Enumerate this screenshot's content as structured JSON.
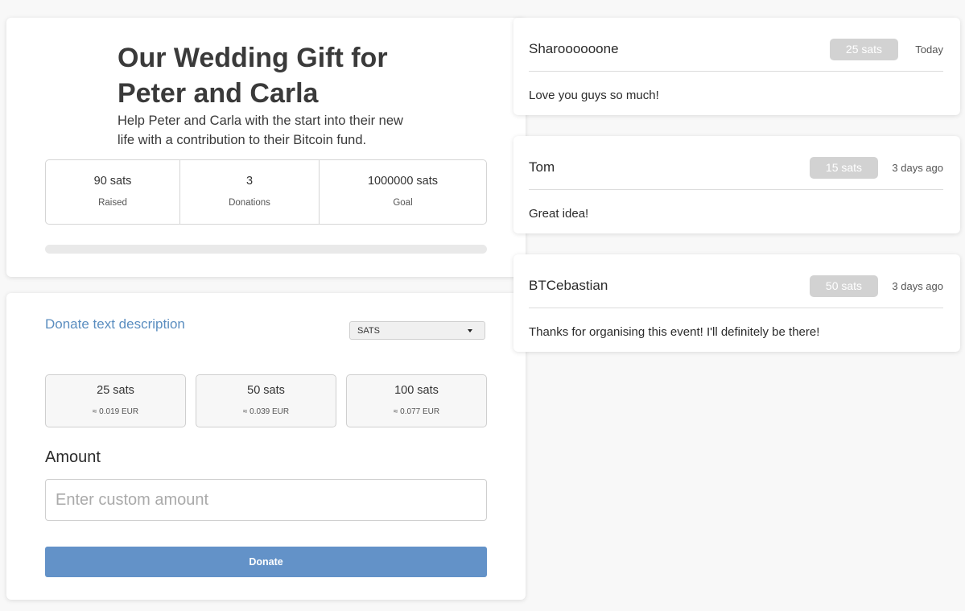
{
  "campaign": {
    "title": "Our Wedding Gift for Peter and Carla",
    "description": "Help Peter and Carla with the start into their new life with a contribution to their Bitcoin fund.",
    "stats": [
      {
        "value": "90 sats",
        "label": "Raised"
      },
      {
        "value": "3",
        "label": "Donations"
      },
      {
        "value": "1000000 sats",
        "label": "Goal"
      }
    ],
    "progress_fraction": 9e-05
  },
  "donate": {
    "description": "Donate text description",
    "currency": {
      "selected": "SATS"
    },
    "presets": [
      {
        "sats": "25 sats",
        "eur": "≈ 0.019 EUR"
      },
      {
        "sats": "50 sats",
        "eur": "≈ 0.039 EUR"
      },
      {
        "sats": "100 sats",
        "eur": "≈ 0.077 EUR"
      }
    ],
    "amount_label": "Amount",
    "amount_placeholder": "Enter custom amount",
    "amount_value": "",
    "button_label": "Donate"
  },
  "donations": [
    {
      "name": "Sharoooooone",
      "amount": "25 sats",
      "date": "Today",
      "message": "Love you guys so much!"
    },
    {
      "name": "Tom",
      "amount": "15 sats",
      "date": "3 days ago",
      "message": "Great idea!"
    },
    {
      "name": "BTCebastian",
      "amount": "50 sats",
      "date": "3 days ago",
      "message": "Thanks for organising this event! I'll definitely be there!"
    }
  ],
  "colors": {
    "accent": "#6392c8",
    "link": "#5b8ec0",
    "pill": "#d2d2d2",
    "background": "#f8f8f8"
  }
}
